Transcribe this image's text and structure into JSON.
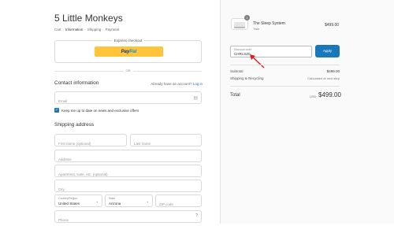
{
  "store": {
    "title": "5 Little Monkeys"
  },
  "breadcrumb": [
    "Cart",
    "Information",
    "Shipping",
    "Payment"
  ],
  "express": {
    "label": "Express checkout",
    "paypal_1": "Pay",
    "paypal_2": "Pal"
  },
  "or_text": "OR",
  "contact": {
    "heading": "Contact information",
    "login_prefix": "Already have an account?",
    "login_link": "Log in",
    "email_placeholder": "Email",
    "newsletter_label": "Keep me up to date on news and exclusive offers"
  },
  "shipping": {
    "heading": "Shipping address",
    "first_name_placeholder": "First name (optional)",
    "last_name_placeholder": "Last name",
    "address_placeholder": "Address",
    "apartment_placeholder": "Apartment, suite, etc. (optional)",
    "city_placeholder": "City",
    "country_label": "Country/Region",
    "country_value": "United States",
    "state_label": "State",
    "state_value": "Arizona",
    "zip_placeholder": "ZIP code",
    "phone_placeholder": "Phone"
  },
  "summary": {
    "quantity": "1",
    "product_name": "The Sleep System",
    "product_variant": "Twin",
    "product_price": "$499.00",
    "discount_label": "Discount code",
    "discount_value": "CHRLSZ0",
    "apply_label": "Apply",
    "subtotal_label": "Subtotal",
    "subtotal_value": "$499.00",
    "shipping_label": "Shipping & Recycling",
    "shipping_value": "Calculated at next step",
    "total_label": "Total",
    "total_currency": "USD",
    "total_value": "$499.00"
  },
  "colors": {
    "accent": "#1878b9",
    "paypal_yellow": "#ffc439",
    "arrow": "#d62020"
  }
}
